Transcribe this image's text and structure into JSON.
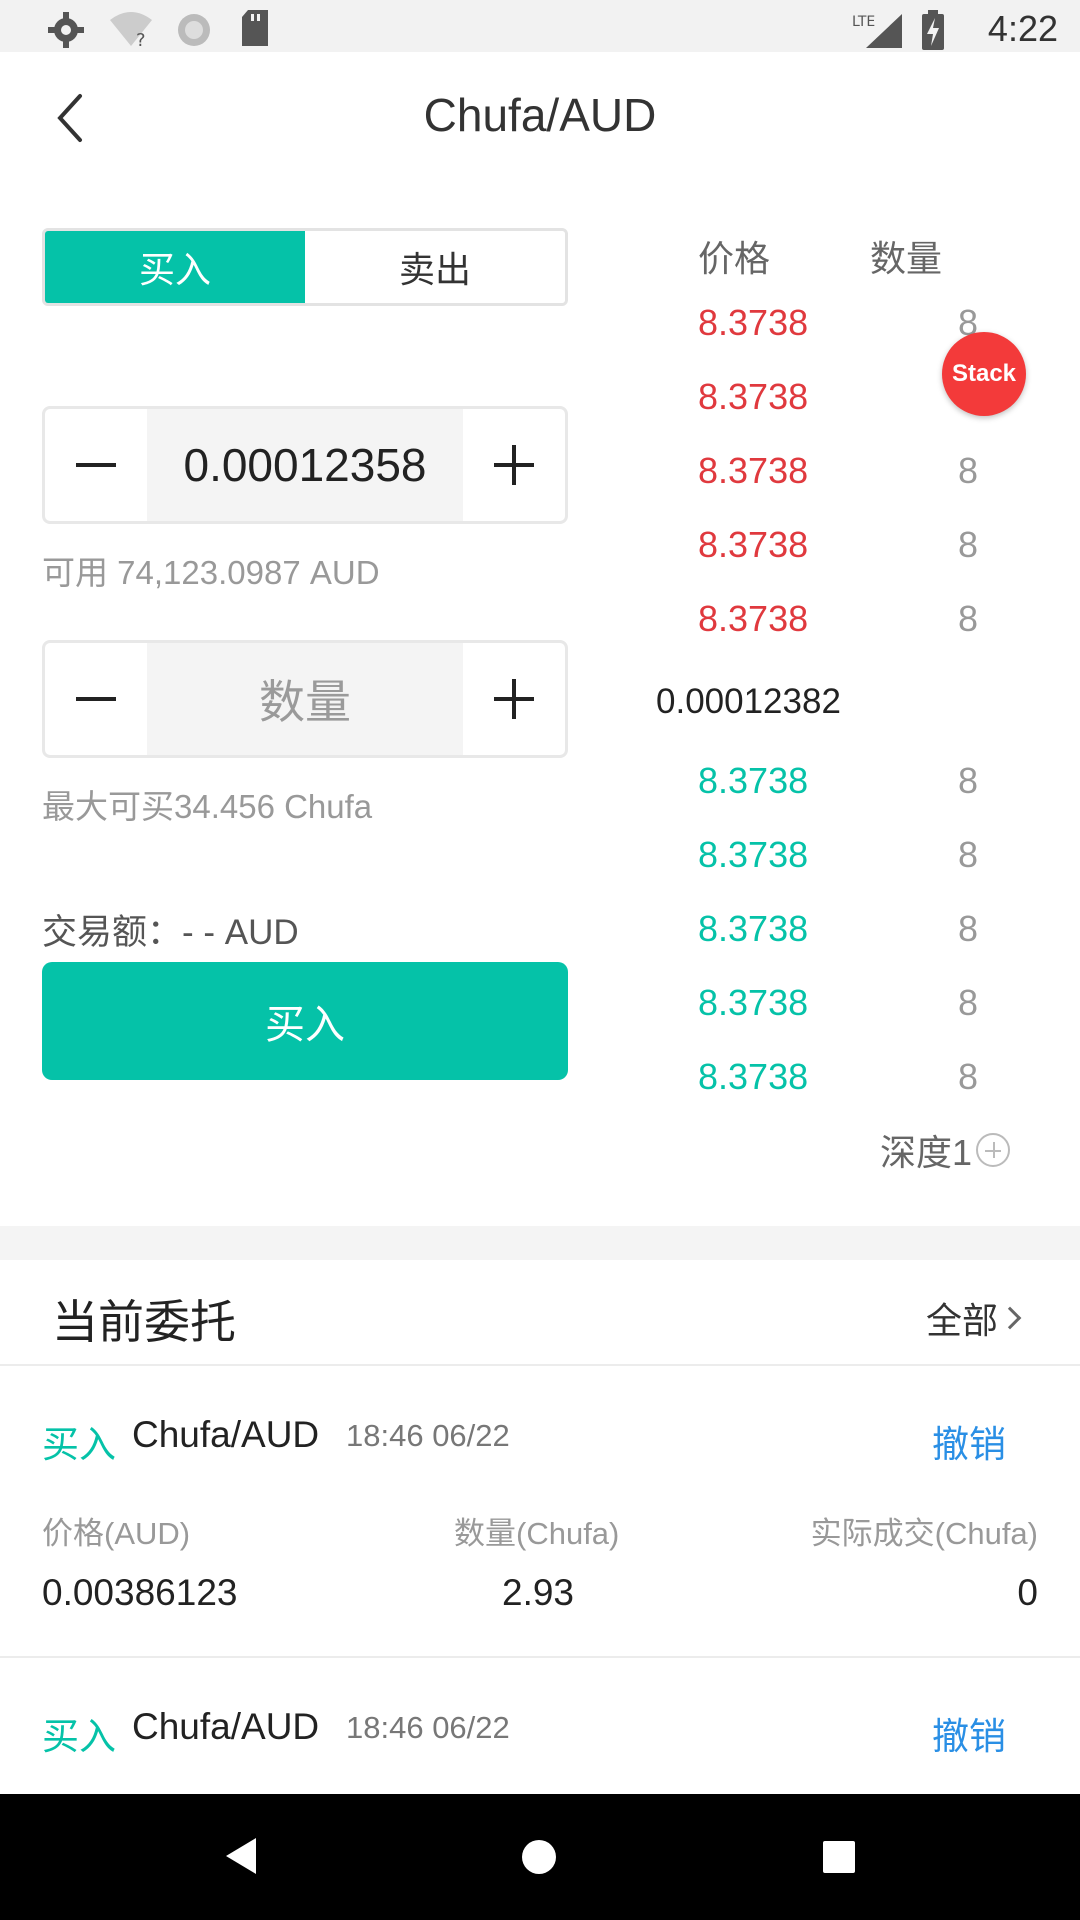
{
  "status_bar": {
    "time": "4:22",
    "icons": [
      "settings-icon",
      "wifi-question-icon",
      "sync-icon",
      "sd-card-icon",
      "lte-signal-icon",
      "battery-charging-icon"
    ],
    "network_label": "LTE"
  },
  "header": {
    "title": "Chufa/AUD"
  },
  "trade_tabs": {
    "buy": "买入",
    "sell": "卖出",
    "active": "buy"
  },
  "price_input": {
    "value": "0.00012358"
  },
  "available": "可用 74,123.0987 AUD",
  "quantity_input": {
    "placeholder": "数量",
    "value": ""
  },
  "max_buy": "最大可买34.456 Chufa",
  "trade_amount": "交易额：- - AUD",
  "buy_button": "买入",
  "order_book": {
    "price_header": "价格",
    "qty_header": "数量",
    "asks": [
      {
        "price": "8.3738",
        "qty": "8"
      },
      {
        "price": "8.3738",
        "qty": ""
      },
      {
        "price": "8.3738",
        "qty": "8"
      },
      {
        "price": "8.3738",
        "qty": "8"
      },
      {
        "price": "8.3738",
        "qty": "8"
      }
    ],
    "last_price": "0.00012382",
    "bids": [
      {
        "price": "8.3738",
        "qty": "8"
      },
      {
        "price": "8.3738",
        "qty": "8"
      },
      {
        "price": "8.3738",
        "qty": "8"
      },
      {
        "price": "8.3738",
        "qty": "8"
      },
      {
        "price": "8.3738",
        "qty": "8"
      }
    ],
    "depth_label": "深度1",
    "ask_color": "#e0393e",
    "bid_color": "#05c2a8"
  },
  "stack_badge": "Stack",
  "current_orders": {
    "title": "当前委托",
    "all_label": "全部",
    "orders": [
      {
        "side": "买入",
        "pair": "Chufa/AUD",
        "time": "18:46 06/22",
        "cancel": "撤销",
        "price_label": "价格(AUD)",
        "qty_label": "数量(Chufa)",
        "filled_label": "实际成交(Chufa)",
        "price": "0.00386123",
        "qty": "2.93",
        "filled": "0"
      },
      {
        "side": "买入",
        "pair": "Chufa/AUD",
        "time": "18:46 06/22",
        "cancel": "撤销"
      }
    ]
  },
  "colors": {
    "accent": "#05c2a8",
    "ask": "#e0393e",
    "link": "#2a8fe5"
  }
}
